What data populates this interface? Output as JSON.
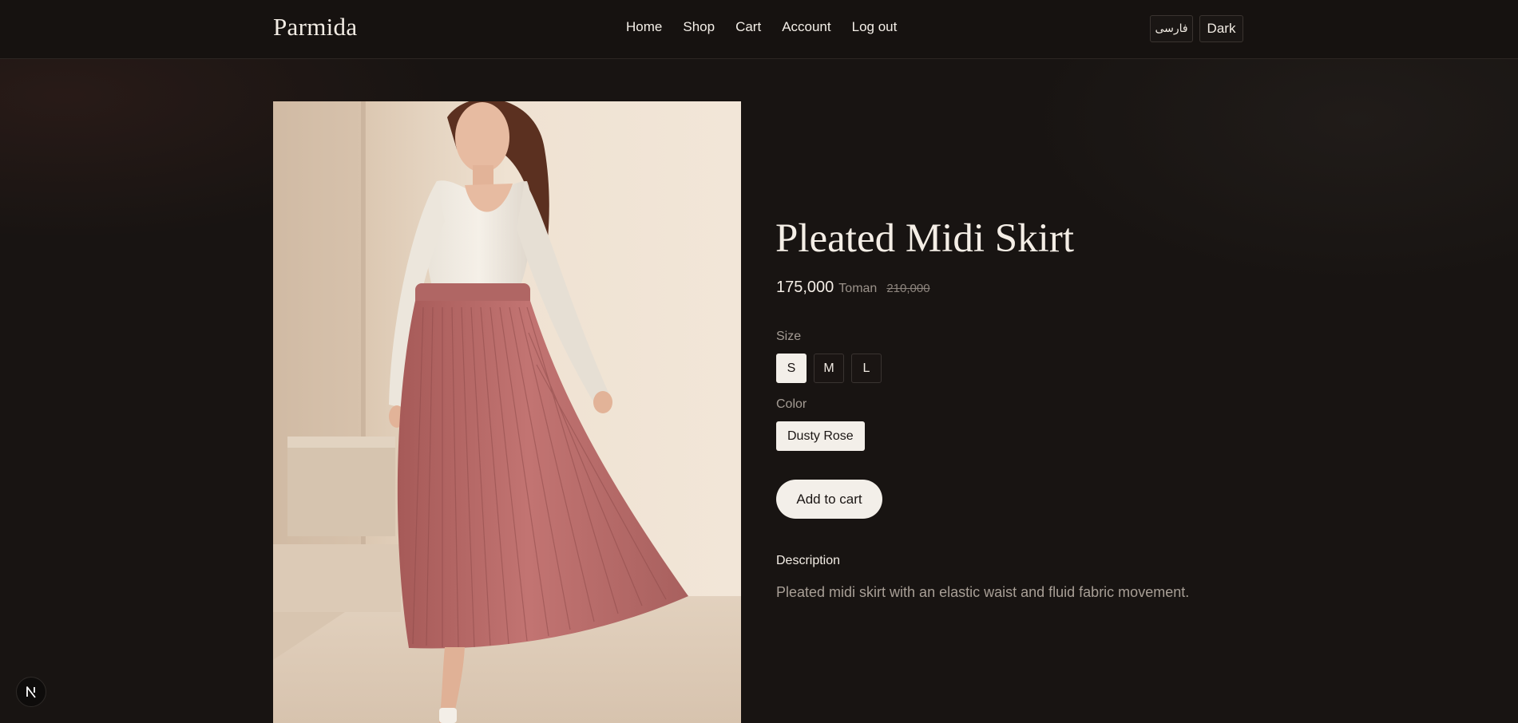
{
  "header": {
    "brand": "Parmida",
    "nav": [
      "Home",
      "Shop",
      "Cart",
      "Account",
      "Log out"
    ],
    "language_button": "فارسی",
    "theme_button": "Dark"
  },
  "product": {
    "title": "Pleated Midi Skirt",
    "price": "175,000",
    "currency": "Toman",
    "old_price": "210,000",
    "size_label": "Size",
    "sizes": [
      "S",
      "M",
      "L"
    ],
    "selected_size": "S",
    "color_label": "Color",
    "color": "Dusty Rose",
    "add_to_cart": "Add to cart",
    "description_heading": "Description",
    "description": "Pleated midi skirt with an elastic waist and fluid fabric movement.",
    "image_alt": "Woman wearing a dusty rose pleated midi skirt and cream knit top"
  },
  "colors": {
    "background": "#181412",
    "skirt": "#b76a68",
    "accent_light": "#f3efe9"
  },
  "dev_badge_icon": "nextjs-icon"
}
